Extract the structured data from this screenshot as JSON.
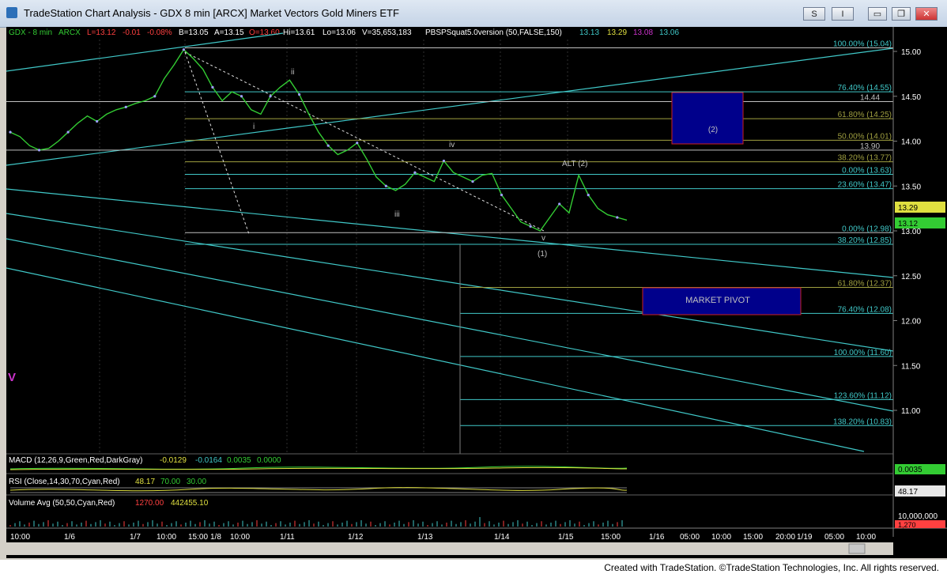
{
  "window": {
    "title": "TradeStation Chart Analysis - GDX 8 min [ARCX] Market Vectors Gold Miners ETF",
    "buttons": [
      "S",
      "I"
    ]
  },
  "header": {
    "symbol": "GDX - 8 min",
    "exchange": "ARCX",
    "last": "L=13.12",
    "change": "-0.01",
    "pct": "-0.08%",
    "bid": "B=13.05",
    "ask": "A=13.15",
    "open": "O=13.60",
    "high": "Hi=13.61",
    "low": "Lo=13.06",
    "volume": "V=35,653,183",
    "indicator": "PBSPSquat5.0version (50,FALSE,150)",
    "ind_values": [
      "13.13",
      "13.29",
      "13.08",
      "13.06"
    ]
  },
  "footer": "Created with TradeStation. ©TradeStation Technologies, Inc. All rights reserved.",
  "colors": {
    "price": "#33cc33",
    "trendline": "#40c8c8",
    "fib_cyan": "#40c8c8",
    "fib_olive": "#a0a040",
    "box_fill": "#00008b",
    "box_border": "#cc2020",
    "text_gray": "#c0c0c0",
    "magenta": "#cc33cc"
  },
  "chart_data": {
    "type": "line",
    "title": "GDX 8 min",
    "ylim": [
      10.5,
      15.3
    ],
    "y_ticks": [
      "15.00",
      "14.50",
      "14.00",
      "13.50",
      "13.00",
      "12.50",
      "12.00",
      "11.50",
      "11.00"
    ],
    "x_ticks": [
      "10:00",
      "1/6",
      "1/7",
      "10:00",
      "15:00",
      "1/8",
      "10:00",
      "1/11",
      "1/12",
      "1/13",
      "1/14",
      "1/15",
      "15:00",
      "1/16",
      "05:00",
      "10:00",
      "15:00",
      "20:00",
      "1/19",
      "05:00",
      "10:00"
    ],
    "series": [
      {
        "name": "GDX",
        "values": [
          14.1,
          14.05,
          13.95,
          13.9,
          13.92,
          14.0,
          14.1,
          14.2,
          14.28,
          14.22,
          14.3,
          14.35,
          14.38,
          14.42,
          14.45,
          14.5,
          14.7,
          14.85,
          15.02,
          14.92,
          14.8,
          14.6,
          14.45,
          14.55,
          14.5,
          14.35,
          14.3,
          14.5,
          14.6,
          14.68,
          14.52,
          14.3,
          14.1,
          13.95,
          13.85,
          13.9,
          13.98,
          13.8,
          13.6,
          13.5,
          13.45,
          13.52,
          13.65,
          13.6,
          13.55,
          13.78,
          13.65,
          13.6,
          13.55,
          13.62,
          13.64,
          13.4,
          13.25,
          13.1,
          13.05,
          13.0,
          13.15,
          13.3,
          13.2,
          13.62,
          13.4,
          13.25,
          13.18,
          13.15,
          13.12
        ]
      }
    ],
    "fib_levels": [
      {
        "label": "100.00% (15.04)",
        "value": 15.04
      },
      {
        "label": "76.40% (14.55)",
        "value": 14.55
      },
      {
        "label": "61.80% (14.25)",
        "value": 14.25
      },
      {
        "label": "50.00% (14.01)",
        "value": 14.01
      },
      {
        "label": "38.20% (13.77)",
        "value": 13.77
      },
      {
        "label": "0.00% (13.63)",
        "value": 13.63
      },
      {
        "label": "23.60% (13.47)",
        "value": 13.47
      },
      {
        "label": "0.00% (12.98)",
        "value": 12.98
      },
      {
        "label": "38.20% (12.85)",
        "value": 12.85
      },
      {
        "label": "61.80% (12.37)",
        "value": 12.37
      },
      {
        "label": "76.40% (12.08)",
        "value": 12.08
      },
      {
        "label": "100.00% (11.60)",
        "value": 11.6
      },
      {
        "label": "123.60% (11.12)",
        "value": 11.12
      },
      {
        "label": "138.20% (10.83)",
        "value": 10.83
      }
    ],
    "horizontal_lines": [
      {
        "label": "14.44",
        "value": 14.44
      },
      {
        "label": "13.90",
        "value": 13.9
      }
    ],
    "wave_labels": [
      "i",
      "ii",
      "iii",
      "iv",
      "v",
      "(1)",
      "ALT (2)",
      "(2)"
    ],
    "boxes": [
      "(2)",
      "MARKET PIVOT"
    ],
    "price_tags": [
      "13.29",
      "13.12"
    ],
    "big_marker": "V",
    "indicators": {
      "macd": {
        "label": "MACD (12,26,9,Green,Red,DarkGray)",
        "values": [
          "-0.0129",
          "-0.0164",
          "0.0035",
          "0.0000"
        ],
        "tag": "0.0035"
      },
      "rsi": {
        "label": "RSI (Close,14,30,70,Cyan,Red)",
        "values": [
          "48.17",
          "70.00",
          "30.00"
        ],
        "tag": "48.17"
      },
      "volume": {
        "label": "Volume Avg (50,50,Cyan,Red)",
        "values": [
          "1270.00",
          "442455.10"
        ],
        "axis": [
          "10,000,000",
          "1,270"
        ]
      }
    }
  }
}
